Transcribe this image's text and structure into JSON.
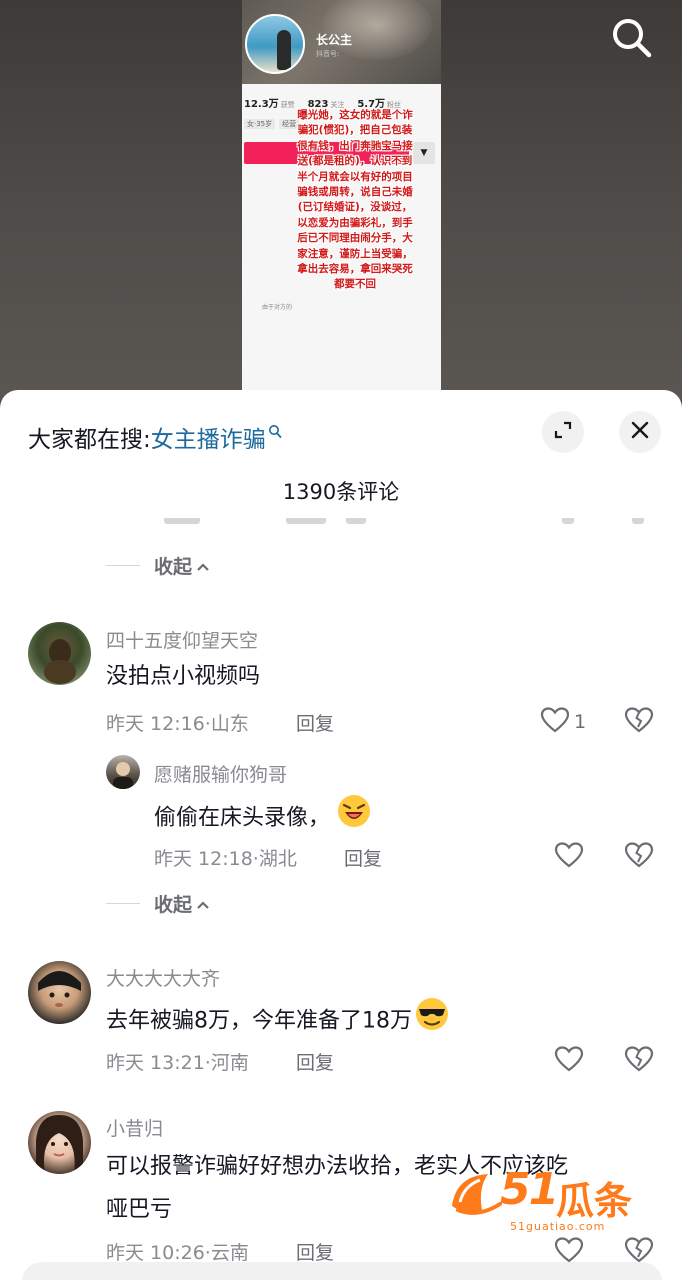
{
  "video": {
    "profile_name": "长公主",
    "profile_sub": "抖音号:",
    "stats": [
      {
        "value": "12.3万",
        "label": "获赞"
      },
      {
        "value": "823",
        "label": "关注"
      },
      {
        "value": "5.7万",
        "label": "粉丝"
      }
    ],
    "tags": [
      "女·35岁",
      "经营"
    ],
    "dropdown": "▼",
    "footnote": "由于对方的",
    "overlay_text": "曝光她，这女的就是个诈骗犯(惯犯)，把自己包装很有钱，出门奔驰宝马接送(都是租的)，认识不到半个月就会以有好的项目骗钱或周转，说自己未婚(已订结婚证)，没谈过，以恋爱为由骗彩礼，到手后已不同理由闹分手，大家注意，谨防上当受骗，拿出去容易，拿回来哭死都要不回"
  },
  "sheet": {
    "search_prefix": "大家都在搜:",
    "search_keyword": "女主播诈骗",
    "comment_count": "1390条评论",
    "collapse_label": "收起",
    "reply_label": "回复"
  },
  "comments": [
    {
      "user": "四十五度仰望天空",
      "text": "没拍点小视频吗",
      "time": "昨天 12:16",
      "location": "山东",
      "likes": "1",
      "replies": [
        {
          "user": "愿赌服输你狗哥",
          "text": "偷偷在床头录像，",
          "time": "昨天 12:18",
          "location": "湖北"
        }
      ]
    },
    {
      "user": "大大大大大齐",
      "text": "去年被骗8万，今年准备了18万",
      "time": "昨天 13:21",
      "location": "河南"
    },
    {
      "user": "小昔归",
      "text_line1": "可以报警诈骗好好想办法收拾，老实人不应该吃",
      "text_line2": "哑巴亏",
      "time": "昨天 10:26",
      "location": "云南"
    }
  ],
  "watermark": {
    "number": "51",
    "chinese": "瓜条",
    "url": "51guatiao.com"
  },
  "colors": {
    "keyword": "#1c6a9e",
    "overlay_red": "#d11919",
    "pink_bar": "#f2215a",
    "watermark_orange": "#ff7a1a"
  }
}
